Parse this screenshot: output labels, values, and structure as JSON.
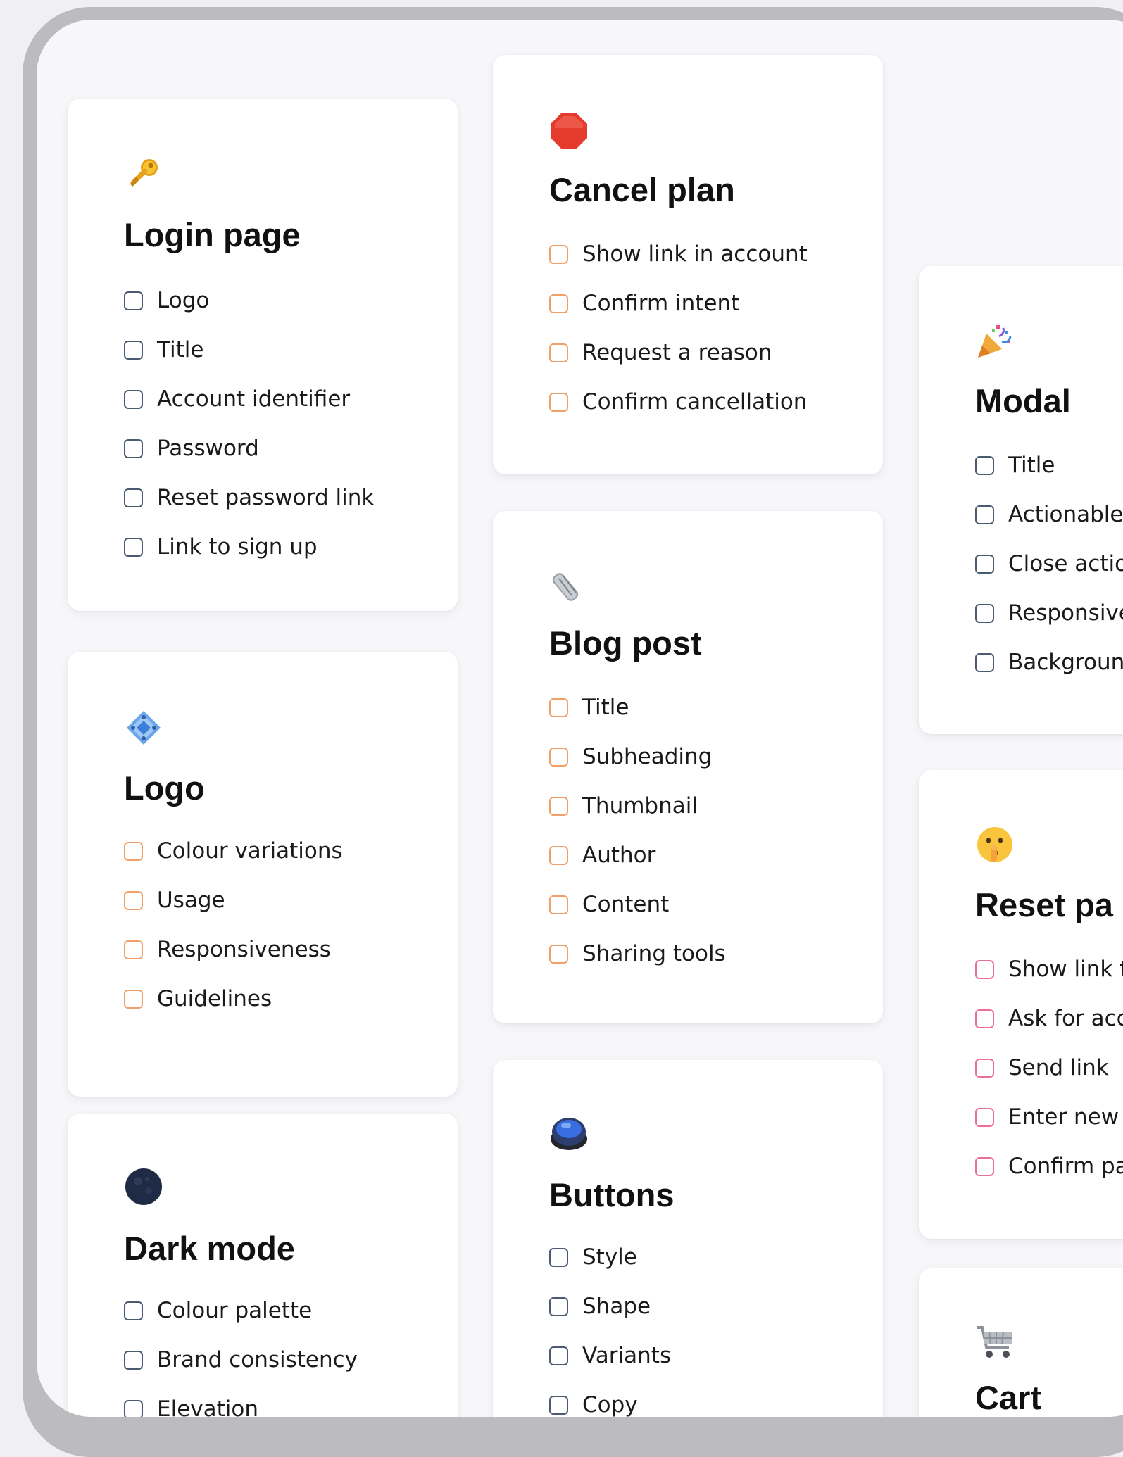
{
  "cards": {
    "login": {
      "title": "Login page",
      "icon": "key-icon",
      "checkbox_color": "#4a5a72",
      "items": [
        "Logo",
        "Title",
        "Account identifier",
        "Password",
        "Reset password link",
        "Link to sign up"
      ]
    },
    "logo": {
      "title": "Logo",
      "icon": "diamond-shapes-icon",
      "checkbox_color": "#f0a068",
      "items": [
        "Colour variations",
        "Usage",
        "Responsiveness",
        "Guidelines"
      ]
    },
    "dark": {
      "title": "Dark mode",
      "icon": "new-moon-icon",
      "checkbox_color": "#4a5a72",
      "items": [
        "Colour palette",
        "Brand consistency",
        "Elevation"
      ]
    },
    "cancel": {
      "title": "Cancel plan",
      "icon": "stop-sign-icon",
      "checkbox_color": "#f0a068",
      "items": [
        "Show link in account",
        "Confirm intent",
        "Request a reason",
        "Confirm cancellation"
      ]
    },
    "blog": {
      "title": "Blog post",
      "icon": "rolled-newspaper-icon",
      "checkbox_color": "#f0a068",
      "items": [
        "Title",
        "Subheading",
        "Thumbnail",
        "Author",
        "Content",
        "Sharing tools"
      ]
    },
    "buttons": {
      "title": "Buttons",
      "icon": "push-button-icon",
      "checkbox_color": "#4a5a72",
      "items": [
        "Style",
        "Shape",
        "Variants",
        "Copy"
      ]
    },
    "modal": {
      "title": "Modal",
      "icon": "party-popper-icon",
      "checkbox_color": "#4a5a72",
      "items": [
        "Title",
        "Actionable",
        "Close actio",
        "Responsive",
        "Backgroun"
      ]
    },
    "reset": {
      "title": "Reset pa",
      "icon": "shushing-face-icon",
      "checkbox_color": "#ec6f95",
      "items": [
        "Show link t",
        "Ask for acc",
        "Send link",
        "Enter new p",
        "Confirm pa"
      ]
    },
    "cart": {
      "title": "Cart",
      "icon": "shopping-cart-icon"
    }
  }
}
